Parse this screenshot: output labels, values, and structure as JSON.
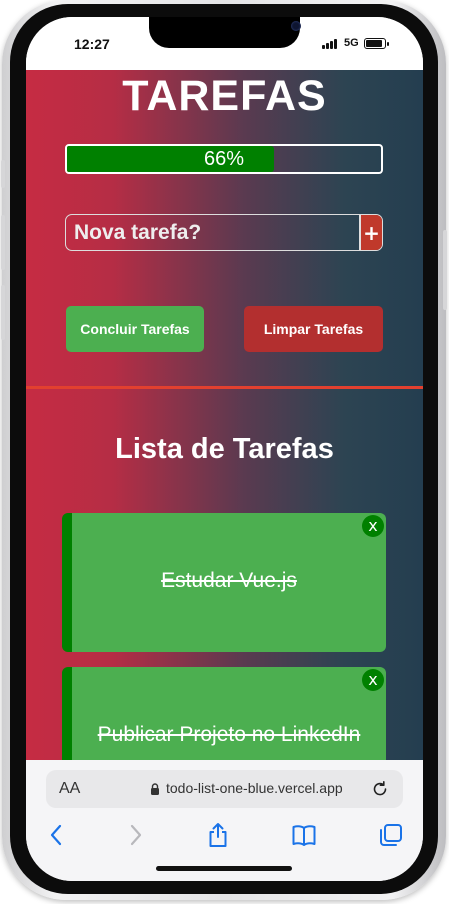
{
  "status_bar": {
    "time": "12:27",
    "network": "5G"
  },
  "app": {
    "title": "TAREFAS",
    "progress": {
      "percent": 66,
      "label": "66%"
    },
    "new_task_placeholder": "Nova tarefa?",
    "add_button_label": "+",
    "complete_button_label": "Concluir Tarefas",
    "clear_button_label": "Limpar Tarefas",
    "list_title": "Lista de Tarefas",
    "tasks": [
      {
        "text": "Estudar Vue.js",
        "done": true,
        "close_label": "x"
      },
      {
        "text": "Publicar Projeto no LinkedIn",
        "done": true,
        "close_label": "x"
      }
    ]
  },
  "browser": {
    "aa_label": "AA",
    "url": "todo-list-one-blue.vercel.app"
  },
  "colors": {
    "accent_green": "#4caf50",
    "dark_green": "#008000",
    "clear_red": "#b32f2f",
    "divider_red": "#e2402f",
    "gradient_left": "#c62c43",
    "gradient_right": "#243e50"
  },
  "icons": {
    "lock": "lock-icon",
    "reload": "reload-icon",
    "back": "chevron-left-icon",
    "forward": "chevron-right-icon",
    "share": "share-icon",
    "bookmarks": "book-icon",
    "tabs": "tabs-icon"
  }
}
